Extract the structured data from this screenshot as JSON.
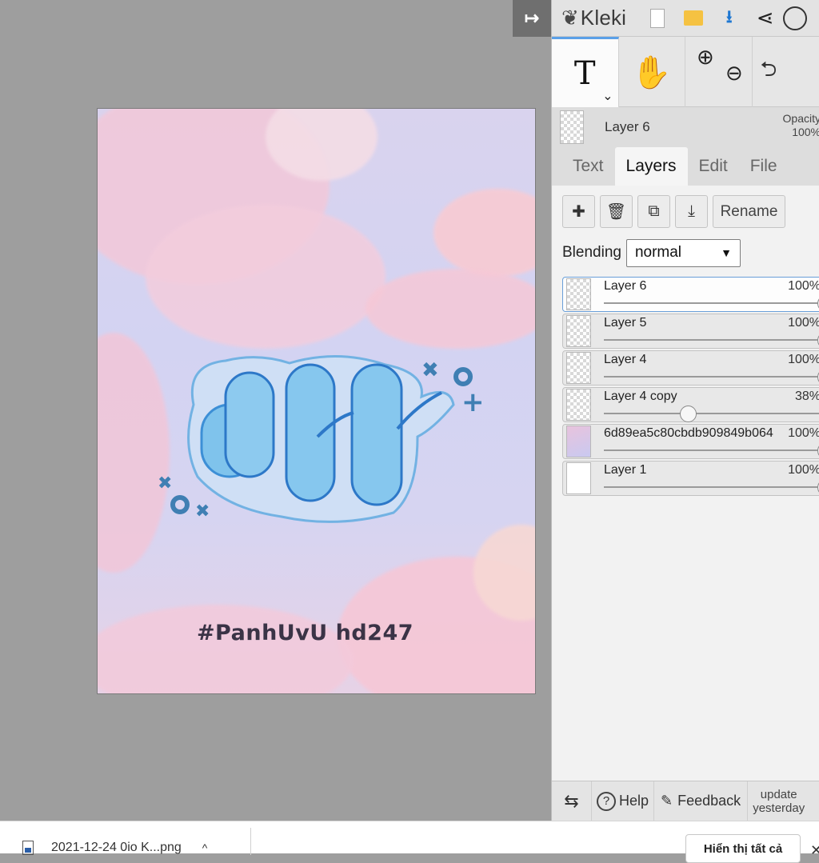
{
  "colors": {
    "panel_bg": "#dddddd",
    "accent": "#5aa0e8",
    "stage_bg": "#9e9e9e"
  },
  "stage": {
    "collapse_icon": "arrow-right-to-bar-icon",
    "artwork_caption": "#PanhUvU  hd247"
  },
  "app": {
    "name": "Kleki"
  },
  "toolbar": {
    "icons": [
      "new-image-icon",
      "open-folder-icon",
      "download-icon",
      "share-icon",
      "help-icon"
    ]
  },
  "tools": {
    "text_glyph": "T",
    "text_caret": "⌄",
    "hand_glyph": "✋",
    "zoom_in_glyph": "⊕",
    "zoom_out_glyph": "⊖",
    "undo_glyph": "⮌"
  },
  "layer_info": {
    "name": "Layer 6",
    "opacity_label": "Opacity",
    "opacity_value": "100%"
  },
  "tabs": [
    {
      "label": "Text"
    },
    {
      "label": "Layers"
    },
    {
      "label": "Edit"
    },
    {
      "label": "File"
    }
  ],
  "layer_actions": {
    "rename_label": "Rename"
  },
  "blending": {
    "label": "Blending",
    "value": "normal"
  },
  "layers": [
    {
      "name": "Layer 6",
      "opacity": "100%",
      "level": 1.0
    },
    {
      "name": "Layer 5",
      "opacity": "100%",
      "level": 1.0
    },
    {
      "name": "Layer 4",
      "opacity": "100%",
      "level": 1.0
    },
    {
      "name": "Layer 4 copy",
      "opacity": "38%",
      "level": 0.38
    },
    {
      "name": "6d89ea5c80cbdb909849b064",
      "opacity": "100%",
      "level": 1.0
    },
    {
      "name": "Layer 1",
      "opacity": "100%",
      "level": 1.0
    }
  ],
  "footer": {
    "help_label": "Help",
    "feedback_label": "Feedback",
    "update_line1": "update",
    "update_line2": "yesterday"
  },
  "download_bar": {
    "file_name": "2021-12-24 0io K...png",
    "show_all_label": "Hiển thị tất cả",
    "close_glyph": "✕"
  }
}
